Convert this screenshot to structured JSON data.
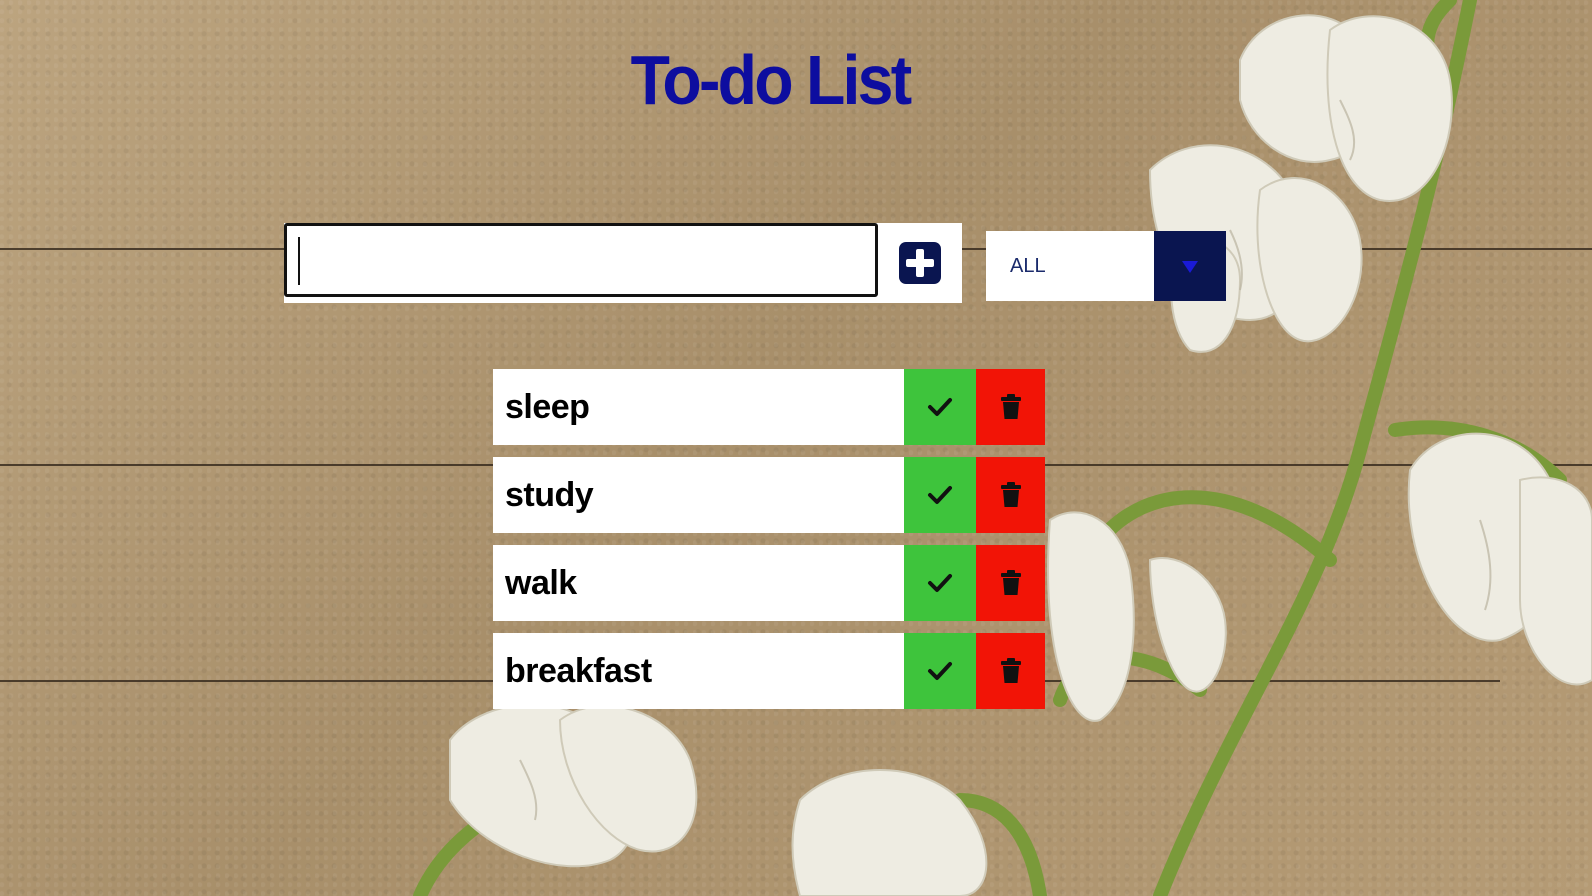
{
  "app": {
    "title": "To-do List"
  },
  "input": {
    "value": "",
    "placeholder": ""
  },
  "add_button": {
    "icon": "plus-square-icon"
  },
  "filter": {
    "selected": "ALL",
    "icon": "caret-down-icon"
  },
  "todos": [
    {
      "text": "sleep"
    },
    {
      "text": "study"
    },
    {
      "text": "walk"
    },
    {
      "text": "breakfast"
    }
  ],
  "item_actions": {
    "complete_icon": "check-icon",
    "delete_icon": "trash-icon"
  },
  "colors": {
    "title": "#0d0d9f",
    "complete": "#3ec43c",
    "delete": "#f21406",
    "select_arrow_bg": "#0a1550",
    "select_arrow": "#1a1ad6",
    "add_icon": "#0a1550"
  }
}
